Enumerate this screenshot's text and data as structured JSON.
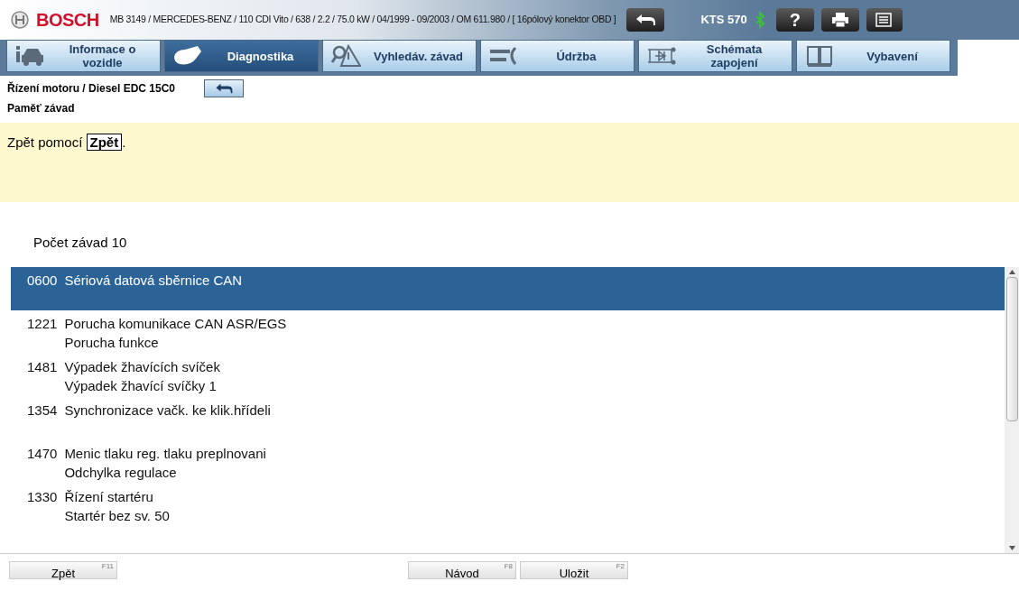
{
  "header": {
    "brand": "BOSCH",
    "vehicle": "MB 3149 / MERCEDES-BENZ / 110 CDI Vito / 638 / 2.2 / 75.0 kW / 04/1999 - 09/2003 / OM 611.980 / [ 16pólový konektor OBD ]",
    "device": "KTS 570",
    "help": "?"
  },
  "tabs": [
    {
      "label": "Informace o vozidle",
      "kind": "car",
      "selected": false
    },
    {
      "label": "Diagnostika",
      "kind": "plug",
      "selected": true
    },
    {
      "label": "Vyhledáv. závad",
      "kind": "warning",
      "selected": false
    },
    {
      "label": "Údržba",
      "kind": "tools",
      "selected": false
    },
    {
      "label": "Schémata zapojení",
      "kind": "circuit",
      "selected": false
    },
    {
      "label": "Vybavení",
      "kind": "book",
      "selected": false
    }
  ],
  "breadcrumb": "Řízení motoru / Diesel EDC 15C0",
  "section": "Paměť závad",
  "notice": "Zpět pomocí **Zpět**.",
  "count": "Počet závad 10",
  "faults": [
    {
      "code": "0600",
      "lines": [
        "Sériová datová sběrnice CAN"
      ],
      "selected": true
    },
    {
      "code": "1221",
      "lines": [
        "Porucha komunikace CAN ASR/EGS",
        "Porucha funkce"
      ],
      "selected": false
    },
    {
      "code": "1481",
      "lines": [
        "Výpadek žhavících svíček",
        "Výpadek žhavící svíčky 1"
      ],
      "selected": false
    },
    {
      "code": "1354",
      "lines": [
        "Synchronizace vačk. ke klik.hřídeli"
      ],
      "selected": false
    },
    {
      "code": "1470",
      "lines": [
        "Menic tlaku reg. tlaku preplnovani",
        "Odchylka regulace"
      ],
      "selected": false
    },
    {
      "code": "1330",
      "lines": [
        "Řízení startéru",
        "Startér bez sv. 50"
      ],
      "selected": false
    }
  ],
  "footer_buttons": [
    {
      "label": "Zpět",
      "key": "F11"
    },
    {
      "label": "Návod",
      "key": "F8"
    },
    {
      "label": "Uložit",
      "key": "F2"
    }
  ]
}
